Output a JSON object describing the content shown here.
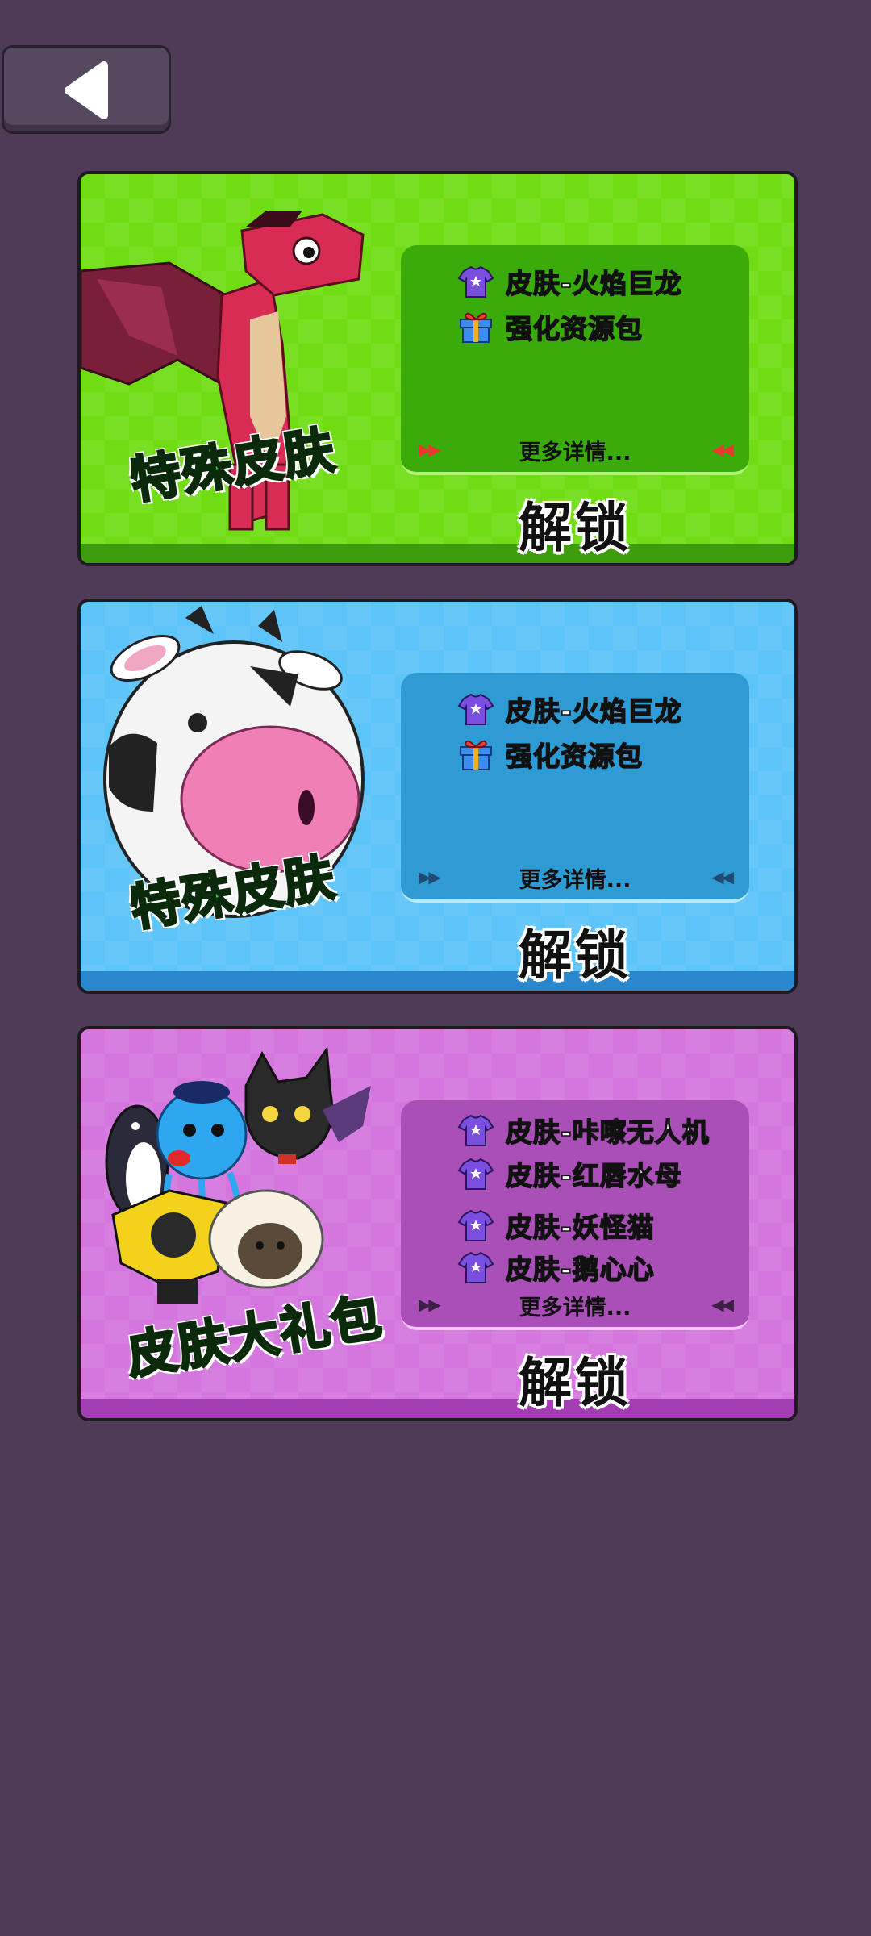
{
  "back_button": {
    "icon": "back-arrow-icon"
  },
  "cards": [
    {
      "theme": "green",
      "badge": "特殊皮肤",
      "items": [
        {
          "icon": "shirt-icon",
          "label": "皮肤-火焰巨龙"
        },
        {
          "icon": "gift-icon",
          "label": "强化资源包"
        }
      ],
      "more": "更多详情...",
      "unlock": "解锁"
    },
    {
      "theme": "blue",
      "badge": "特殊皮肤",
      "items": [
        {
          "icon": "shirt-icon",
          "label": "皮肤-火焰巨龙"
        },
        {
          "icon": "gift-icon",
          "label": "强化资源包"
        }
      ],
      "more": "更多详情...",
      "unlock": "解锁"
    },
    {
      "theme": "purple",
      "badge": "皮肤大礼包",
      "items": [
        {
          "icon": "shirt-icon",
          "label": "皮肤-咔嚓无人机"
        },
        {
          "icon": "shirt-icon",
          "label": "皮肤-红唇水母"
        },
        {
          "icon": "shirt-icon",
          "label": "皮肤-妖怪猫"
        },
        {
          "icon": "shirt-icon",
          "label": "皮肤-鹅心心"
        }
      ],
      "more": "更多详情...",
      "unlock": "解锁"
    }
  ],
  "colors": {
    "background": "#4f3b58",
    "green_card": "#70dd14",
    "blue_card": "#5cc4f8",
    "purple_card": "#d576df",
    "badge_text": "#22d93a"
  }
}
